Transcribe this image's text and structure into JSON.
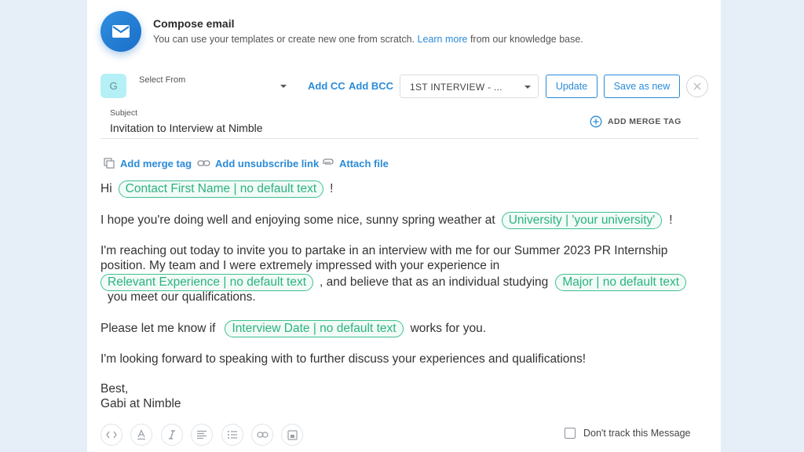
{
  "header": {
    "title": "Compose email",
    "subtitle_before": "You can use your templates or create new one from scratch. ",
    "subtitle_link": "Learn more",
    "subtitle_after": " from our knowledge base.",
    "icon": "envelope-icon"
  },
  "sender": {
    "avatar_letter": "G",
    "select_label": "Select From"
  },
  "toolbar": {
    "add_cc": "Add CC",
    "add_bcc": "Add BCC",
    "template_value": "1ST INTERVIEW - ...",
    "update": "Update",
    "save_as_new": "Save as new"
  },
  "subject": {
    "label": "Subject",
    "value": "Invitation to Interview at Nimble",
    "add_merge_tag": "ADD MERGE TAG"
  },
  "editor_tools": {
    "add_merge_tag": "Add merge tag",
    "add_unsubscribe_link": "Add unsubscribe link",
    "attach_file": "Attach file"
  },
  "body": {
    "line1_pre": "Hi",
    "tag_first_name": "Contact First Name | no default text",
    "line1_post": "!",
    "line2_pre": "I hope you're doing well and enjoying some nice, sunny spring weather at",
    "tag_university": "University | 'your university'",
    "line2_post": "!",
    "line3a": "I'm reaching out today to invite you to partake in an interview with me for our Summer 2023 PR Internship",
    "line3b": "position. My team and I were extremely impressed with your experience in",
    "tag_experience": "Relevant Experience | no default text",
    "line3c_mid": ", and believe that as an individual studying",
    "tag_major": "Major | no default text",
    "line3d": "you meet our qualifications.",
    "line4_pre": "Please let me know if",
    "tag_interview_date": "Interview Date | no default text",
    "line4_post": "works for you.",
    "line5": "I'm looking forward to speaking with to further discuss your experiences and qualifications!",
    "signoff": "Best,",
    "signature": "Gabi at Nimble"
  },
  "footer": {
    "dont_track": "Don't track this Message"
  },
  "colors": {
    "accent": "#2a8bd8",
    "tag_green": "#2bb37f"
  }
}
